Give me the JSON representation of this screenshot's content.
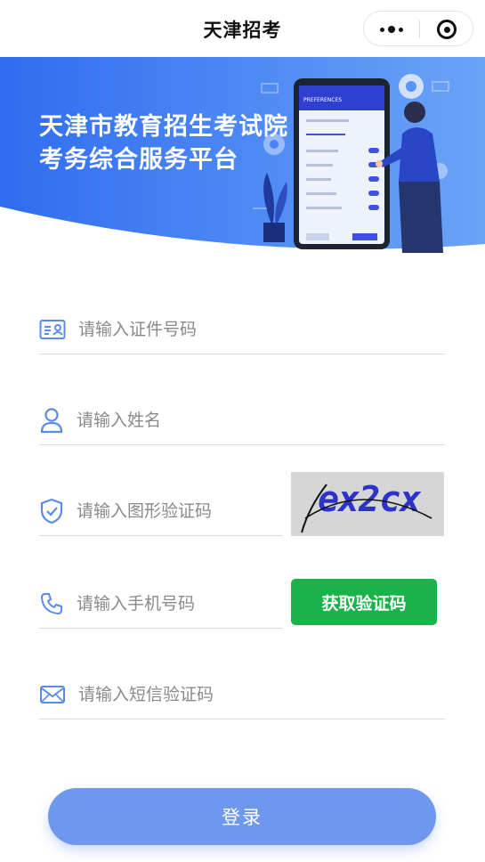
{
  "navbar": {
    "title": "天津招考",
    "more_icon": "more-dots-icon",
    "close_icon": "target-close-icon"
  },
  "banner": {
    "line1": "天津市教育招生考试院",
    "line2": "考务综合服务平台",
    "phone_header": "PREFERENCES",
    "gradient_start": "#2f6df0",
    "gradient_end": "#6aa4f7"
  },
  "form": {
    "id_number": {
      "placeholder": "请输入证件号码",
      "value": "",
      "icon": "id-card-icon"
    },
    "name": {
      "placeholder": "请输入姓名",
      "value": "",
      "icon": "user-icon"
    },
    "captcha_field": {
      "placeholder": "请输入图形验证码",
      "value": "",
      "icon": "shield-check-icon"
    },
    "captcha_image": {
      "text": "ex2cx"
    },
    "phone": {
      "placeholder": "请输入手机号码",
      "value": "",
      "icon": "phone-icon"
    },
    "sms_button": "获取验证码",
    "sms_code": {
      "placeholder": "请输入短信验证码",
      "value": "",
      "icon": "envelope-icon"
    }
  },
  "login_button": "登录",
  "colors": {
    "accent": "#4a7ef0",
    "icon": "#5a8be8",
    "sms_button": "#1ab34a",
    "login_button": "#6d98ee"
  }
}
